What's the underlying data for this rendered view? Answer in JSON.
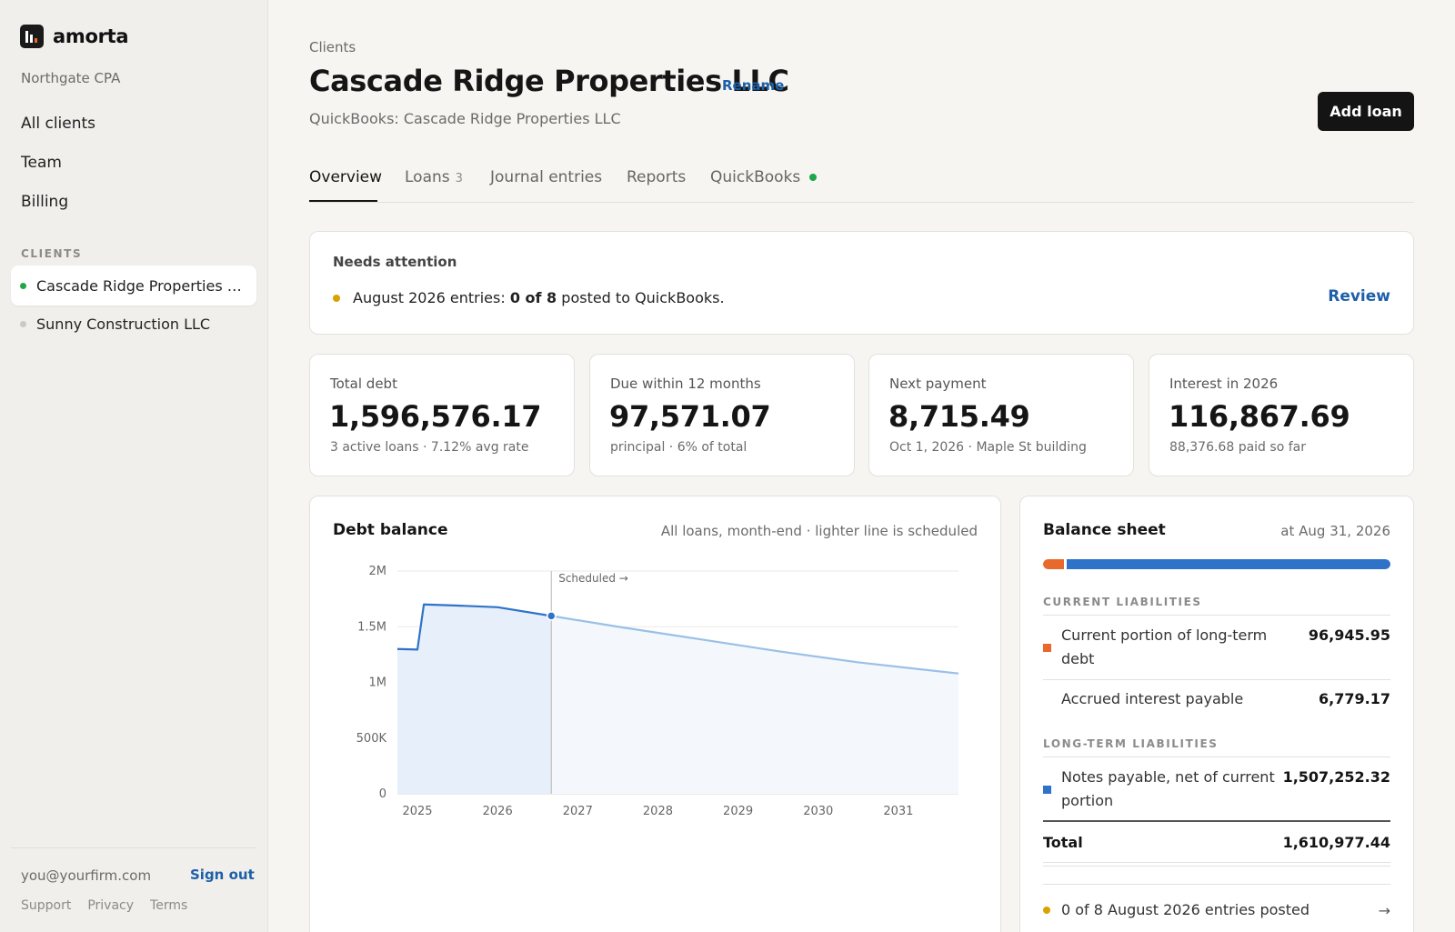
{
  "brand": {
    "name": "amorta"
  },
  "firm": "Northgate CPA",
  "nav": [
    "All clients",
    "Team",
    "Billing"
  ],
  "clients_section": "CLIENTS",
  "clients": [
    {
      "name": "Cascade Ridge Properties L...",
      "status_color": "#1fa64a",
      "active": true
    },
    {
      "name": "Sunny Construction LLC",
      "status_color": "#c9c9c9",
      "active": false
    }
  ],
  "footer": {
    "email": "you@yourfirm.com",
    "signout": "Sign out",
    "links": [
      "Support",
      "Privacy",
      "Terms"
    ]
  },
  "page": {
    "breadcrumb": "Clients",
    "title": "Cascade Ridge Properties LLC",
    "rename": "Rename",
    "quickbooks_sub": "QuickBooks: Cascade Ridge Properties LLC",
    "add_loan": "Add loan"
  },
  "tabs": [
    {
      "label": "Overview",
      "active": true
    },
    {
      "label": "Loans",
      "count": "3"
    },
    {
      "label": "Journal entries"
    },
    {
      "label": "Reports"
    },
    {
      "label": "QuickBooks",
      "status_color": "#1fa64a"
    }
  ],
  "attention": {
    "title": "Needs attention",
    "prefix": "August 2026 entries:",
    "bold": "0 of 8",
    "suffix": "posted to QuickBooks.",
    "action": "Review"
  },
  "kpis": [
    {
      "label": "Total debt",
      "value": "1,596,576.17",
      "note": "3 active loans · 7.12% avg rate"
    },
    {
      "label": "Due within 12 months",
      "value": "97,571.07",
      "note": "principal · 6% of total"
    },
    {
      "label": "Next payment",
      "value": "8,715.49",
      "note": "Oct 1, 2026 · Maple St building"
    },
    {
      "label": "Interest in 2026",
      "value": "116,867.69",
      "note": "88,376.68 paid so far"
    }
  ],
  "debt_chart": {
    "title": "Debt balance",
    "note": "All loans, month-end · lighter line is scheduled",
    "marker_label": "Scheduled →"
  },
  "chart_data": {
    "type": "area",
    "title": "Debt balance",
    "xlabel": "",
    "ylabel": "",
    "x_ticks": [
      "2025",
      "2026",
      "2027",
      "2028",
      "2029",
      "2030",
      "2031"
    ],
    "y_ticks": [
      "0",
      "500K",
      "1M",
      "1.5M",
      "2M"
    ],
    "ylim": [
      0,
      2000000
    ],
    "xlim": [
      2024.75,
      2031.75
    ],
    "series": [
      {
        "style": "actual",
        "color": "#2f73c9",
        "points": [
          [
            2024.75,
            1300000
          ],
          [
            2025.0,
            1295000
          ],
          [
            2025.08,
            1700000
          ],
          [
            2025.5,
            1690000
          ],
          [
            2026.0,
            1675000
          ],
          [
            2026.67,
            1597000
          ]
        ]
      },
      {
        "style": "scheduled",
        "color": "#9ac0e6",
        "points": [
          [
            2026.67,
            1597000
          ],
          [
            2027.5,
            1500000
          ],
          [
            2028.5,
            1390000
          ],
          [
            2029.5,
            1280000
          ],
          [
            2030.5,
            1180000
          ],
          [
            2031.75,
            1080000
          ]
        ]
      }
    ],
    "today_x": 2026.67,
    "grid": true
  },
  "balance_sheet": {
    "title": "Balance sheet",
    "date": "at Aug 31, 2026",
    "bar": {
      "current_color": "#e8692c",
      "longterm_color": "#2f73c9"
    },
    "current_label": "CURRENT LIABILITIES",
    "rows_current": [
      {
        "label": "Current portion of long-term debt",
        "value": "96,945.95",
        "color": "#e8692c"
      },
      {
        "label": "Accrued interest payable",
        "value": "6,779.17"
      }
    ],
    "longterm_label": "LONG-TERM LIABILITIES",
    "rows_longterm": [
      {
        "label": "Notes payable, net of current portion",
        "value": "1,507,252.32",
        "color": "#2f73c9"
      }
    ],
    "total_label": "Total",
    "total_value": "1,610,977.44",
    "footer": "0 of 8 August 2026 entries posted",
    "footer_arrow": "→"
  }
}
